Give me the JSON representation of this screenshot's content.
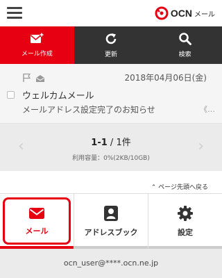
{
  "header": {
    "menu_icon": "hamburger-menu-icon",
    "logo": {
      "brand": "OCN",
      "product": "メール",
      "brand_color": "#e60012"
    }
  },
  "toolbar": {
    "items": [
      {
        "label": "メール作成",
        "icon": "compose-mail-icon",
        "active": true
      },
      {
        "label": "更新",
        "icon": "refresh-icon",
        "active": false
      },
      {
        "label": "検索",
        "icon": "search-icon",
        "active": false
      }
    ]
  },
  "messages": [
    {
      "date": "2018年04月06日(金)",
      "from": "ウェルカムメール",
      "subject": "メールアドレス設定完了のお知らせ",
      "more": "《…",
      "flagged": false,
      "read": true
    }
  ],
  "pager": {
    "range": "1-1",
    "separator": " / ",
    "total": "1件",
    "usage": "利用容量：0%(2KB/10GB)",
    "prev_icon": "chevron-left-icon",
    "next_icon": "chevron-right-icon"
  },
  "back_to_top": "ページ先頭へ戻る",
  "tabs": [
    {
      "label": "メール",
      "icon": "mail-icon",
      "active": true
    },
    {
      "label": "アドレスブック",
      "icon": "address-book-icon",
      "active": false
    },
    {
      "label": "設定",
      "icon": "gear-icon",
      "active": false
    }
  ],
  "footer": {
    "email": "ocn_user@****.ocn.ne.jp"
  },
  "colors": {
    "accent": "#e60012",
    "toolbar_bg": "#333333",
    "panel_bg": "#ebebeb"
  }
}
